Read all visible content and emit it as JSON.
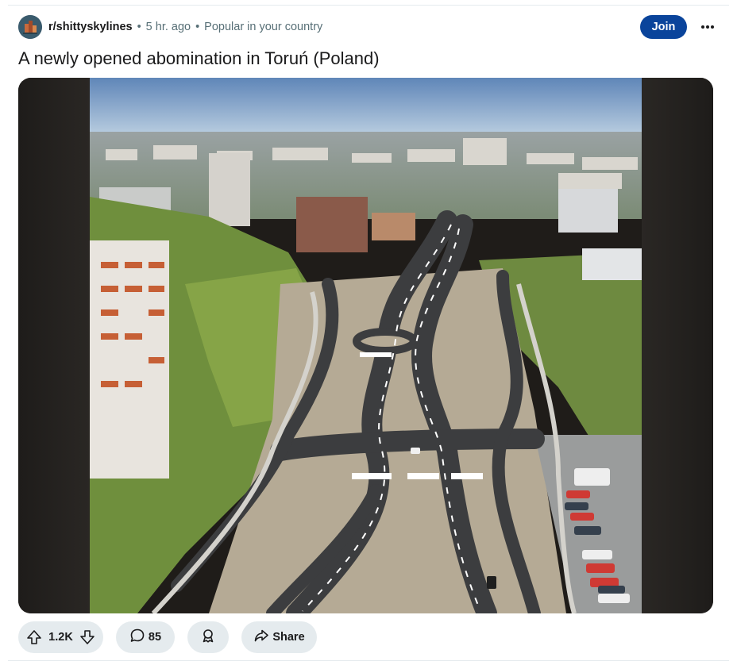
{
  "post": {
    "subreddit": "r/shittyskylines",
    "separator": "•",
    "time_ago": "5 hr. ago",
    "context": "Popular in your country",
    "join_label": "Join",
    "title": "A newly opened abomination in Toruń (Poland)"
  },
  "actions": {
    "score": "1.2K",
    "comments": "85",
    "share_label": "Share"
  },
  "colors": {
    "join_button": "#0a449b",
    "pill_background": "#e5ebee",
    "meta_text": "#576f76"
  },
  "icons": {
    "avatar": "subreddit-avatar-icon",
    "more": "more-options-icon",
    "upvote": "upvote-icon",
    "downvote": "downvote-icon",
    "comment": "comment-icon",
    "award": "award-icon",
    "share": "share-icon"
  }
}
